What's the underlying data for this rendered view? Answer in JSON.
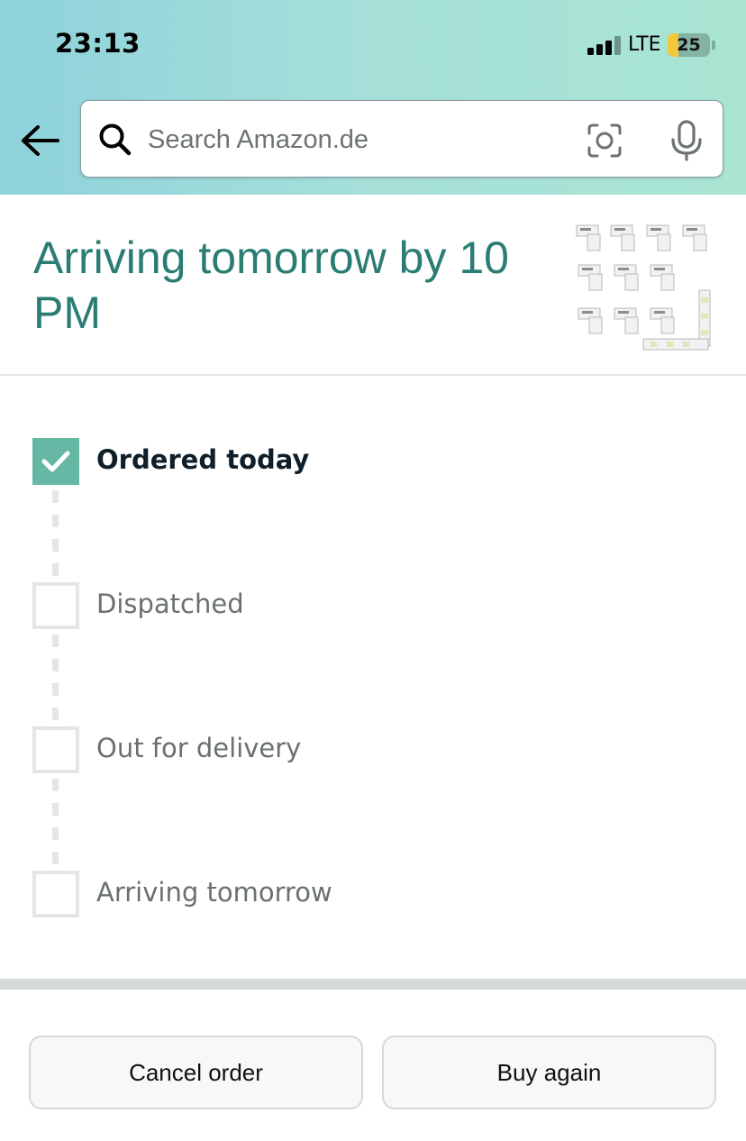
{
  "status_bar": {
    "time": "23:13",
    "network": "LTE",
    "battery_level": "25",
    "battery_fraction": 0.25,
    "battery_color": "#f5c83a"
  },
  "search": {
    "placeholder": "Search Amazon.de",
    "value": ""
  },
  "icons": {
    "back": "arrow-left-icon",
    "search": "search-icon",
    "camera": "camera-scan-icon",
    "mic": "microphone-icon",
    "check": "checkmark-icon"
  },
  "arrival": {
    "title": "Arriving tomorrow by 10 PM"
  },
  "tracker": {
    "steps": [
      {
        "label": "Ordered today",
        "completed": true
      },
      {
        "label": "Dispatched",
        "completed": false
      },
      {
        "label": "Out for delivery",
        "completed": false
      },
      {
        "label": "Arriving tomorrow",
        "completed": false
      }
    ]
  },
  "actions": {
    "cancel_label": "Cancel order",
    "buy_again_label": "Buy again"
  },
  "colors": {
    "accent_teal": "#2b7d74",
    "step_complete": "#67b7a5",
    "step_pending": "#e3e6e6",
    "header_gradient_start": "#8fd2dc",
    "header_gradient_end": "#a9e5d2"
  }
}
